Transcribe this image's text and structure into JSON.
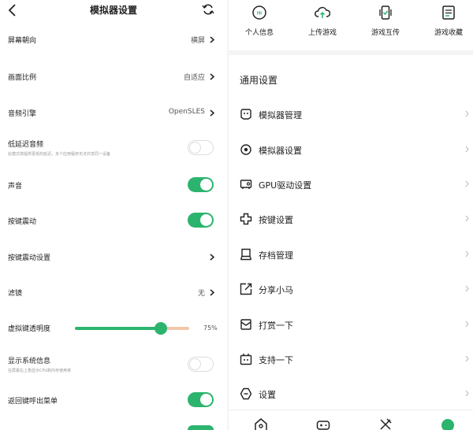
{
  "left": {
    "title": "模拟器设置",
    "rows": [
      {
        "label": "屏幕朝向",
        "value": "横屏"
      },
      {
        "label": "画面比例",
        "value": "自适应"
      },
      {
        "label": "音频引擎",
        "value": "OpenSLES"
      },
      {
        "label": "低延迟音频",
        "sub": "此模式将提供更低的延迟，多个应用程序无法共享同一设备",
        "toggle": "off"
      },
      {
        "label": "声音",
        "toggle": "on"
      },
      {
        "label": "按键震动",
        "toggle": "on"
      },
      {
        "label": "按键震动设置"
      },
      {
        "label": "滤镜",
        "value": "无"
      },
      {
        "label": "虚拟键透明度",
        "slider": 75,
        "slider_text": "75%"
      },
      {
        "label": "显示系统信息",
        "sub": "在屏幕右上角显示CPU和内存使用率",
        "toggle": "off"
      },
      {
        "label": "返回键呼出菜单",
        "toggle": "on"
      }
    ]
  },
  "right": {
    "top_nav": [
      {
        "label": "个人信息",
        "icon": "profile-icon"
      },
      {
        "label": "上传游戏",
        "icon": "upload-icon"
      },
      {
        "label": "游戏互传",
        "icon": "transfer-icon"
      },
      {
        "label": "游戏收藏",
        "icon": "favorite-icon"
      }
    ],
    "section_title": "通用设置",
    "menu": [
      {
        "label": "模拟器管理",
        "icon": "gamepad-icon"
      },
      {
        "label": "模拟器设置",
        "icon": "gear-icon"
      },
      {
        "label": "GPU驱动设置",
        "icon": "gpu-icon"
      },
      {
        "label": "按键设置",
        "icon": "dpad-icon"
      },
      {
        "label": "存档管理",
        "icon": "archive-icon"
      },
      {
        "label": "分享小马",
        "icon": "share-icon"
      },
      {
        "label": "打赏一下",
        "icon": "reward-icon"
      },
      {
        "label": "支持一下",
        "icon": "support-icon"
      },
      {
        "label": "设置",
        "icon": "settings-icon"
      }
    ],
    "bottom_nav": [
      "home-icon",
      "game-icon",
      "tools-icon",
      "me-icon"
    ]
  },
  "colors": {
    "accent": "#2cb46e",
    "slider_rest": "#f3c7a9"
  }
}
